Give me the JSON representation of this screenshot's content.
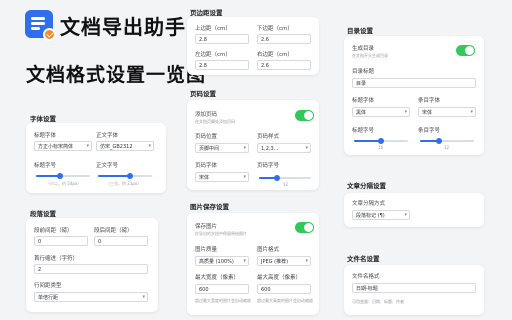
{
  "app": {
    "name": "文档导出助手",
    "headline": "文档格式设置一览图"
  },
  "font_section": {
    "title": "字体设置",
    "title_font_label": "标题字体",
    "title_font_value": "方正小标宋简体",
    "body_font_label": "正文字体",
    "body_font_value": "仿宋_GB2312",
    "title_size_label": "标题字号",
    "title_size_hint": "（小二，约 24px）",
    "title_size_pct": 0.45,
    "body_size_label": "正文字号",
    "body_size_hint": "（三号，约 21px）",
    "body_size_pct": 0.6
  },
  "paragraph_section": {
    "title": "段落设置",
    "before_label": "段前间距（磅）",
    "before_value": "0",
    "after_label": "段后间距（磅）",
    "after_value": "0",
    "indent_label": "首行缩进（字符）",
    "indent_value": "2",
    "line_spacing_label": "行间距类型",
    "line_spacing_value": "单倍行距"
  },
  "margin_section": {
    "title": "页边距设置",
    "top_label": "上边距（cm）",
    "top_value": "2.8",
    "bottom_label": "下边距（cm）",
    "bottom_value": "2.6",
    "left_label": "左边距（cm）",
    "left_value": "2.8",
    "right_label": "右边距（cm）",
    "right_value": "2.6"
  },
  "page_number_section": {
    "title": "页码设置",
    "add_label": "添加页码",
    "add_hint": "在文档页脚处添加页码",
    "add_on": true,
    "position_label": "页码位置",
    "position_value": "页脚中间",
    "style_label": "页码样式",
    "style_value": "1,2,3...",
    "font_label": "页码字体",
    "font_value": "宋体",
    "size_label": "页码字号",
    "size_value": "12",
    "size_pct": 0.35
  },
  "image_section": {
    "title": "图片保存设置",
    "keep_label": "保存图片",
    "keep_hint": "在导出的文档中保留原始图片",
    "keep_on": true,
    "quality_label": "图片质量",
    "quality_value": "高质量 (100%)",
    "format_label": "图片格式",
    "format_value": "JPEG (推荐)",
    "max_width_label": "最大宽度（像素）",
    "max_width_value": "600",
    "max_width_hint": "超过最大宽度的图片会自动缩放",
    "max_height_label": "最大高度（像素）",
    "max_height_value": "600",
    "max_height_hint": "超过最大高度的图片会自动缩放"
  },
  "toc_section": {
    "title": "目录设置",
    "gen_label": "生成目录",
    "gen_hint": "在文档开头生成目录",
    "gen_on": true,
    "toc_title_label": "目录标题",
    "toc_title_value": "目录",
    "title_font_label": "标题字体",
    "title_font_value": "黑体",
    "entry_font_label": "条目字体",
    "entry_font_value": "宋体",
    "title_size_label": "标题字号",
    "title_size_value": "16",
    "title_size_pct": 0.5,
    "entry_size_label": "条目字号",
    "entry_size_value": "12",
    "entry_size_pct": 0.35
  },
  "separator_section": {
    "title": "文章分隔设置",
    "mode_label": "文章分隔方式",
    "mode_value": "段落标记 (¶)"
  },
  "filename_section": {
    "title": "文件名设置",
    "format_label": "文件名格式",
    "format_value": "日期-标题",
    "format_hint": "可用变量：日期、标题、作者"
  }
}
